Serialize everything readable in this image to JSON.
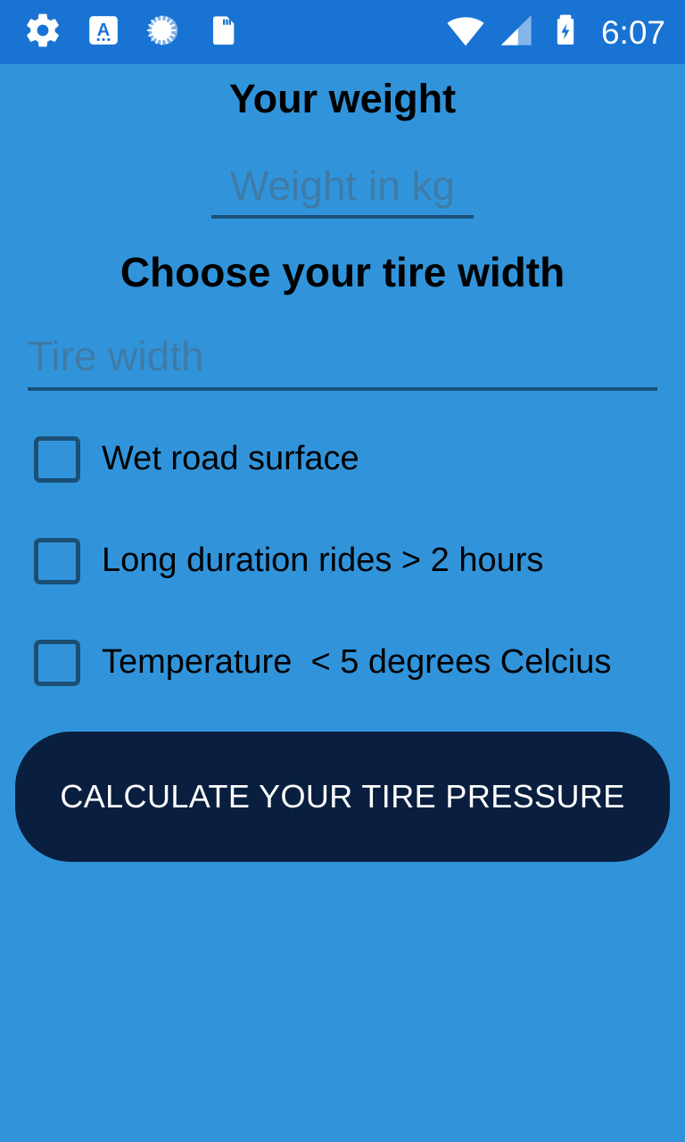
{
  "colors": {
    "background": "#3194db",
    "status_bar": "#1873d3",
    "underline": "#1b5179",
    "placeholder_text": "#3f7ba7",
    "heading_text": "#000000",
    "button_bg": "#0a1f3f",
    "button_text": "#ffffff",
    "checkbox_border": "#1b4f74"
  },
  "status_bar": {
    "left_icons": [
      {
        "name": "settings-gear-icon",
        "label": "Settings"
      },
      {
        "name": "keyboard-language-icon",
        "label": "Keyboard A"
      },
      {
        "name": "sync-spinner-icon",
        "label": "Syncing"
      },
      {
        "name": "sd-card-icon",
        "label": "SD card"
      }
    ],
    "right_icons": [
      {
        "name": "wifi-icon",
        "label": "Wi-Fi full signal"
      },
      {
        "name": "cellular-signal-icon",
        "label": "Cellular signal 2 of 4 bars"
      },
      {
        "name": "battery-charging-icon",
        "label": "Battery charging"
      }
    ],
    "clock": "6:07"
  },
  "form": {
    "weight_heading": "Your weight",
    "weight_input": {
      "placeholder": "Weight in kg",
      "value": ""
    },
    "tire_heading": "Choose your tire width",
    "tire_input": {
      "placeholder": "Tire width",
      "value": ""
    },
    "checkboxes": [
      {
        "label": "Wet road surface",
        "checked": false
      },
      {
        "label": "Long duration rides > 2 hours",
        "checked": false
      },
      {
        "label": "Temperature  < 5 degrees Celcius",
        "checked": false
      }
    ],
    "submit_label": "CALCULATE YOUR TIRE PRESSURE"
  }
}
